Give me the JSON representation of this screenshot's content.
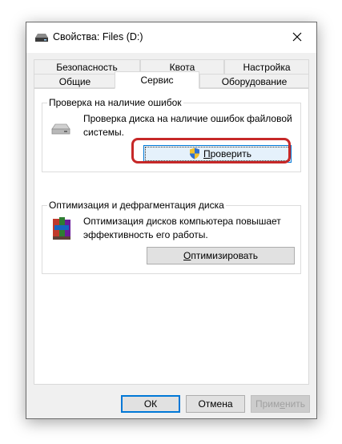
{
  "window": {
    "title": "Свойства: Files (D:)"
  },
  "tabs": {
    "row1": [
      {
        "label": "Безопасность"
      },
      {
        "label": "Квота"
      },
      {
        "label": "Настройка"
      }
    ],
    "row2": [
      {
        "label": "Общие"
      },
      {
        "label": "Сервис"
      },
      {
        "label": "Оборудование"
      }
    ],
    "active": "Сервис"
  },
  "error_check": {
    "legend": "Проверка на наличие ошибок",
    "desc_line1": "Проверка диска на наличие ошибок файловой",
    "desc_line2": "системы.",
    "button_label": "Проверить",
    "button_mnemonic": "П",
    "button_rest": "роверить"
  },
  "optimize": {
    "legend": "Оптимизация и дефрагментация диска",
    "desc_line1": "Оптимизация дисков компьютера повышает",
    "desc_line2": "эффективность его работы.",
    "button_label": "Оптимизировать",
    "button_mnemonic": "О",
    "button_rest": "птимизировать"
  },
  "footer": {
    "ok_label": "ОК",
    "cancel_label": "Отмена",
    "apply_label": "Применить",
    "apply_before": "Прим",
    "apply_mnemonic": "е",
    "apply_after": "нить"
  },
  "colors": {
    "highlight": "#c62828",
    "focus_border": "#0078d7",
    "button_bg": "#e1e1e1"
  }
}
